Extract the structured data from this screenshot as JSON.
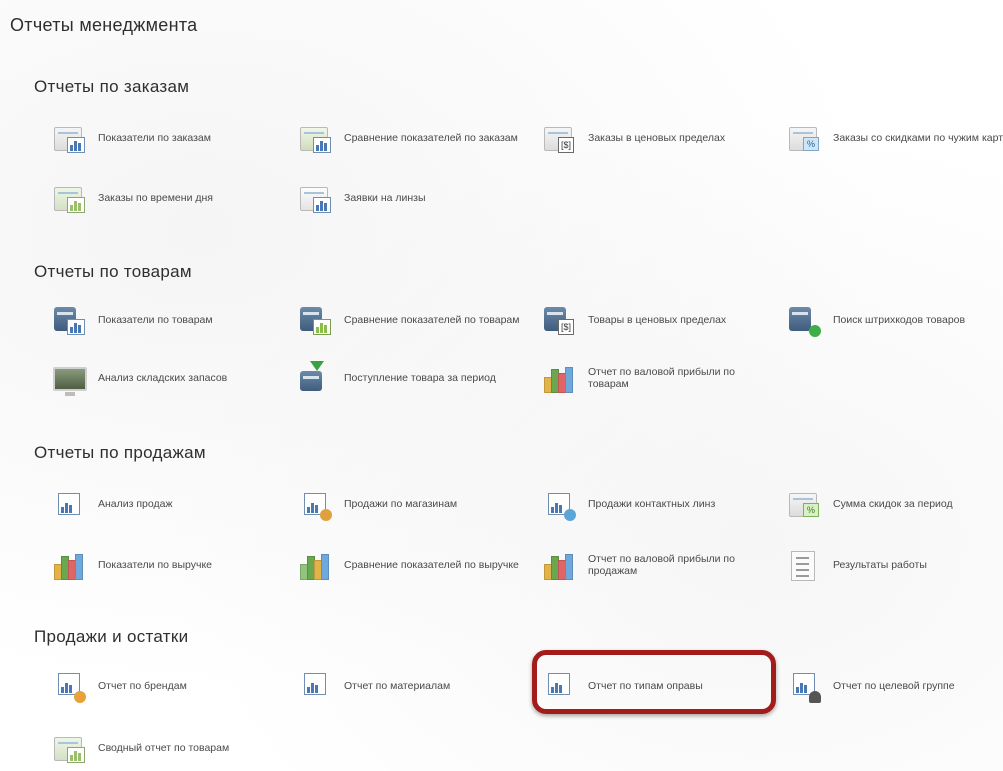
{
  "page": {
    "title": "Отчеты менеджмента"
  },
  "sections": [
    {
      "title": "Отчеты по заказам",
      "items": [
        {
          "label": "Показатели по заказам",
          "icon": "sheet-chart-icon"
        },
        {
          "label": "Сравнение показателей по заказам",
          "icon": "compare-chart-icon"
        },
        {
          "label": "Заказы в ценовых пределах",
          "icon": "price-range-icon"
        },
        {
          "label": "Заказы со скидками по чужим картам",
          "icon": "discount-card-icon"
        },
        {
          "label": "Заказы по времени дня",
          "icon": "time-of-day-icon"
        },
        {
          "label": "Заявки на линзы",
          "icon": "lens-request-icon"
        }
      ]
    },
    {
      "title": "Отчеты по товарам",
      "items": [
        {
          "label": "Показатели по товарам",
          "icon": "product-chart-icon"
        },
        {
          "label": "Сравнение показателей по товарам",
          "icon": "product-compare-icon"
        },
        {
          "label": "Товары в ценовых пределах",
          "icon": "product-price-icon"
        },
        {
          "label": "Поиск штрихкодов товаров",
          "icon": "barcode-search-icon"
        },
        {
          "label": "Анализ складских запасов",
          "icon": "stock-analysis-icon"
        },
        {
          "label": "Поступление товара за период",
          "icon": "goods-receipt-icon"
        },
        {
          "label": "Отчет по валовой прибыли по товарам",
          "icon": "gross-profit-icon"
        }
      ]
    },
    {
      "title": "Отчеты по продажам",
      "items": [
        {
          "label": "Анализ продаж",
          "icon": "sales-analysis-icon"
        },
        {
          "label": "Продажи по магазинам",
          "icon": "store-sales-icon"
        },
        {
          "label": "Продажи контактных линз",
          "icon": "contact-lens-sales-icon"
        },
        {
          "label": "Сумма скидок за период",
          "icon": "discount-sum-icon"
        },
        {
          "label": "Показатели по выручке",
          "icon": "revenue-chart-icon"
        },
        {
          "label": "Сравнение показателей по выручке",
          "icon": "revenue-compare-icon"
        },
        {
          "label": "Отчет по валовой прибыли по продажам",
          "icon": "sales-profit-icon"
        },
        {
          "label": "Результаты работы",
          "icon": "work-results-icon"
        }
      ]
    },
    {
      "title": "Продажи и остатки",
      "items": [
        {
          "label": "Отчет по брендам",
          "icon": "brand-report-icon"
        },
        {
          "label": "Отчет по материалам",
          "icon": "material-report-icon"
        },
        {
          "label": "Отчет по типам оправы",
          "icon": "frame-type-icon",
          "highlighted": true
        },
        {
          "label": "Отчет по целевой группе",
          "icon": "target-group-icon"
        },
        {
          "label": "Сводный отчет по товарам",
          "icon": "summary-report-icon"
        }
      ]
    }
  ],
  "colors": {
    "highlight": "#a21c1c",
    "text": "#4a4a4a",
    "heading": "#2f2f2f"
  }
}
